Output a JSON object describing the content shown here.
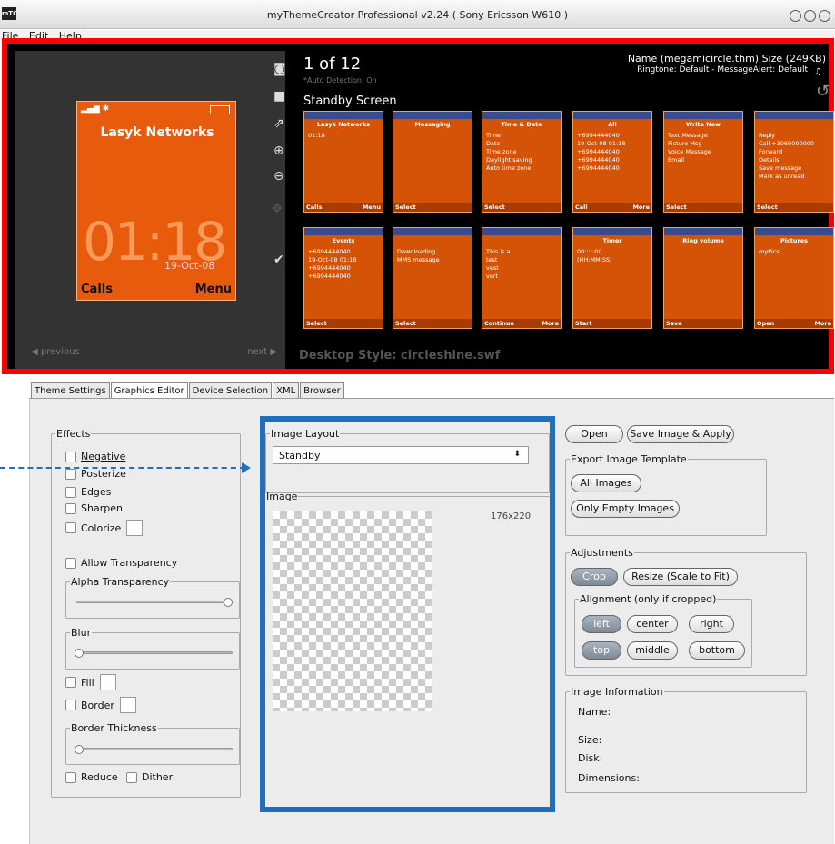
{
  "window": {
    "app_icon_text": "mTC",
    "title": "myThemeCreator Professional v2.24 ( Sony Ericsson W610 )"
  },
  "menu": [
    "File",
    "Edit",
    "Help"
  ],
  "preview": {
    "counter": "1 of 12",
    "auto_detection": "*Auto Detection: On",
    "screen_label": "Standby Screen",
    "theme_name": "Name (megamicircle.thm) Size (249KB)",
    "ringtone": "Ringtone: Default - MessageAlert: Default",
    "phone": {
      "network": "Lasyk Networks",
      "time": "01:18",
      "date": "19-Oct-08",
      "left_soft": "Calls",
      "right_soft": "Menu"
    },
    "prev_label": "previous",
    "next_label": "next",
    "desktop_style": "Desktop Style: circleshine.swf",
    "thumbs_row1": [
      {
        "header": "Lasyk Networks",
        "body": [
          "01:18"
        ],
        "left": "Calls",
        "right": "Menu"
      },
      {
        "header": "Messaging",
        "body": [],
        "left": "Select",
        "right": ""
      },
      {
        "header": "Time & Date",
        "body": [
          "Time",
          "Date",
          "Time zone",
          "Daylight saving",
          "Auto time zone"
        ],
        "left": "Select",
        "right": ""
      },
      {
        "header": "All",
        "body": [
          "+6994444040",
          "19-Oct-08 01:18",
          "+6994444040",
          "+6994444040",
          "+6994444040"
        ],
        "left": "Call",
        "right": "More"
      },
      {
        "header": "Write New",
        "body": [
          "Text Message",
          "Picture Msg",
          "Voice Message",
          "Email"
        ],
        "left": "Select",
        "right": ""
      },
      {
        "header": "",
        "body": [
          "Reply",
          "Call +3069000000",
          "Forward",
          "Details",
          "Save message",
          "Mark as unread"
        ],
        "left": "Select",
        "right": ""
      }
    ],
    "thumbs_row2": [
      {
        "header": "Events",
        "body": [
          "+6994444040",
          "19-Oct-08 01:18",
          "+6994444040",
          "+6994444040"
        ],
        "left": "Select",
        "right": ""
      },
      {
        "header": "",
        "body": [
          "Downloading",
          "MMS message"
        ],
        "left": "Select",
        "right": ""
      },
      {
        "header": "",
        "body": [
          "This is a",
          "test",
          "vest",
          "vert"
        ],
        "left": "Continue",
        "right": "More"
      },
      {
        "header": "Timer",
        "body": [
          "00:::::00",
          "(HH:MM:SS)"
        ],
        "left": "Start",
        "right": ""
      },
      {
        "header": "Ring volume",
        "body": [],
        "left": "Save",
        "right": ""
      },
      {
        "header": "Pictures",
        "body": [
          "myPics"
        ],
        "left": "Open",
        "right": "More"
      }
    ]
  },
  "tabs": [
    "Theme Settings",
    "Graphics Editor",
    "Device Selection",
    "XML",
    "Browser"
  ],
  "effects": {
    "legend": "Effects",
    "negative": "Negative",
    "posterize": "Posterize",
    "edges": "Edges",
    "sharpen": "Sharpen",
    "colorize": "Colorize",
    "allow_transparency": "Allow Transparency",
    "alpha_legend": "Alpha Transparency",
    "blur_legend": "Blur",
    "fill": "Fill",
    "border": "Border",
    "border_thickness_legend": "Border Thickness",
    "reduce": "Reduce",
    "dither": "Dither"
  },
  "layout": {
    "legend": "Image Layout",
    "selected": "Standby",
    "image_legend": "Image",
    "dims": "176x220"
  },
  "right": {
    "open": "Open",
    "save_apply": "Save Image & Apply",
    "export_legend": "Export Image Template",
    "all_images": "All Images",
    "only_empty": "Only Empty Images",
    "adjust_legend": "Adjustments",
    "crop": "Crop",
    "resize": "Resize (Scale to Fit)",
    "align_legend": "Alignment (only if cropped)",
    "left": "left",
    "center": "center",
    "right_btn": "right",
    "top": "top",
    "middle": "middle",
    "bottom": "bottom",
    "info_legend": "Image Information",
    "name": "Name:",
    "size": "Size:",
    "disk": "Disk:",
    "dimensions": "Dimensions:"
  }
}
